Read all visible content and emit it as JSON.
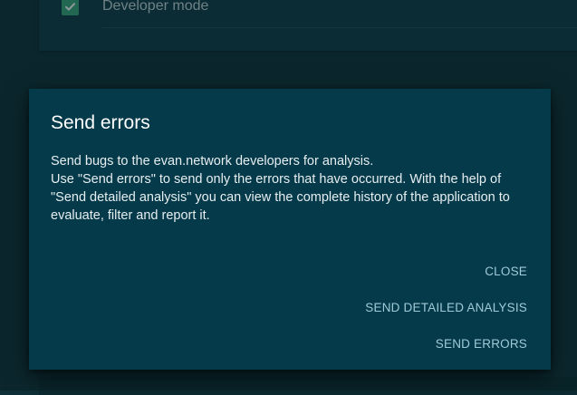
{
  "settings": {
    "developer_mode_label": "Developer mode",
    "developer_mode_checked": true
  },
  "dialog": {
    "title": "Send errors",
    "body_line1": "Send bugs to the evan.network developers for analysis.",
    "body_line2": "Use \"Send errors\" to send only the errors that have occurred. With the help of \"Send detailed analysis\" you can view the complete history of the application to evaluate, filter and report it.",
    "actions": {
      "close": "CLOSE",
      "send_detailed_analysis": "SEND DETAILED ANALYSIS",
      "send_errors": "SEND ERRORS"
    }
  },
  "colors": {
    "background": "#0f3038",
    "dialog": "#053a4a",
    "accent_text": "#9fcbd8",
    "checkbox": "#3aa57a"
  },
  "icons": {
    "checkbox": "checkmark-icon"
  }
}
